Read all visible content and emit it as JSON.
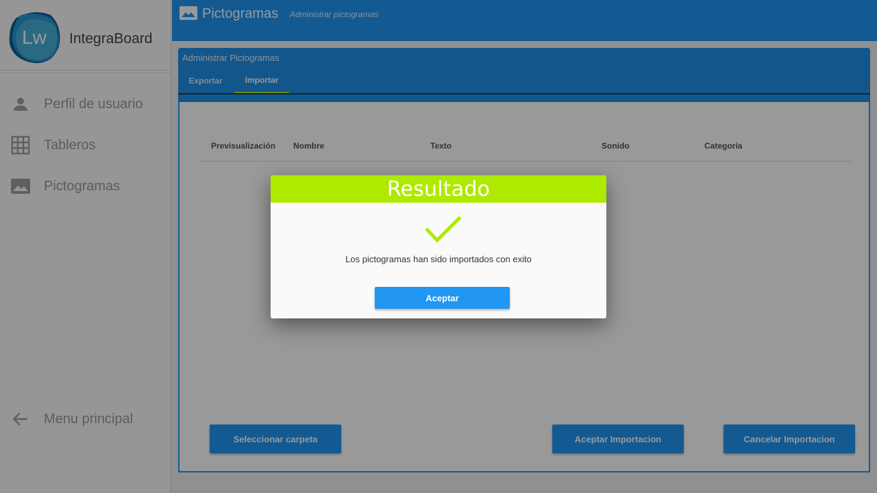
{
  "app": {
    "logo_text": "Lw",
    "name": "IntegraBoard"
  },
  "sidebar": {
    "items": [
      {
        "label": "Perfil de usuario",
        "icon": "person-icon"
      },
      {
        "label": "Tableros",
        "icon": "grid-icon"
      },
      {
        "label": "Pictogramas",
        "icon": "image-icon"
      }
    ],
    "back": {
      "label": "Menu principal",
      "icon": "arrow-back-icon"
    }
  },
  "header": {
    "title": "Pictogramas",
    "subtitle": "Administrar pictogramas",
    "icon": "image-icon"
  },
  "card": {
    "title": "Administrar Pictogramas",
    "tabs": [
      {
        "label": "Exportar",
        "active": false
      },
      {
        "label": "Importar",
        "active": true
      }
    ],
    "columns": [
      "Previsualización",
      "Nombre",
      "Texto",
      "Sonido",
      "Categoría"
    ],
    "buttons": {
      "select_folder": "Seleccionar carpeta",
      "accept_import": "Aceptar Importacion",
      "cancel_import": "Cancelar Importacion"
    }
  },
  "dialog": {
    "title": "Resultado",
    "icon": "check-icon",
    "message": "Los pictogramas han sido importados con exito",
    "ok_label": "Aceptar"
  },
  "colors": {
    "primary": "#2196f3",
    "accent": "#aeea00",
    "overlay": "rgba(0,0,0,0.4)"
  }
}
